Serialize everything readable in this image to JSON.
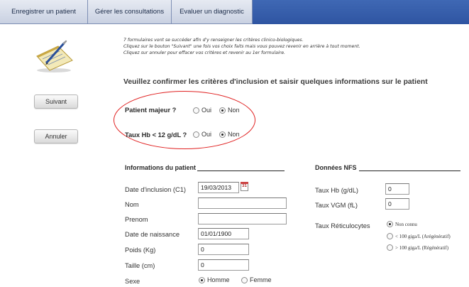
{
  "tabs": [
    {
      "label": "Enregistrer un patient"
    },
    {
      "label": "Gérer les consultations"
    },
    {
      "label": "Evaluer un diagnostic"
    }
  ],
  "instructions": [
    "7 formulaires vont se succéder afin d'y renseigner les critères clinico-biologiques.",
    "Cliquez sur le bouton \"Suivant\" une fois vos choix faits mais vous pouvez revenir en arrière à tout moment.",
    "Cliquez sur annuler pour effacer vos critères et revenir au 1er formulaire."
  ],
  "confirm_title": "Veuillez confirmer les critères d'inclusion et saisir quelques informations sur le patient",
  "buttons": {
    "next": "Suivant",
    "cancel": "Annuler"
  },
  "criteria": {
    "major": {
      "label": "Patient majeur ?",
      "oui": "Oui",
      "non": "Non",
      "selected": "Non"
    },
    "hb": {
      "label": "Taux Hb < 12 g/dL ?",
      "oui": "Oui",
      "non": "Non",
      "selected": "Non"
    }
  },
  "patient_info": {
    "title": "Informations du patient",
    "fields": {
      "inclusion_date": {
        "label": "Date d'inclusion (C1)",
        "value": "19/03/2013"
      },
      "nom": {
        "label": "Nom",
        "value": ""
      },
      "prenom": {
        "label": "Prenom",
        "value": ""
      },
      "birth_date": {
        "label": "Date de naissance",
        "value": "01/01/1900"
      },
      "poids": {
        "label": "Poids (Kg)",
        "value": "0"
      },
      "taille": {
        "label": "Taille (cm)",
        "value": "0"
      }
    },
    "sexe": {
      "label": "Sexe",
      "homme": "Homme",
      "femme": "Femme",
      "selected": "Homme"
    },
    "calendar_day": "31"
  },
  "nfs": {
    "title": "Données NFS",
    "hb": {
      "label": "Taux Hb (g/dL)",
      "value": "0"
    },
    "vgm": {
      "label": "Taux VGM (fL)",
      "value": "0"
    },
    "reticulo": {
      "label": "Taux Réticulocytes",
      "options": [
        "Non connu",
        "< 100 giga/L (Arégénératif)",
        "> 100 giga/L (Régénératif)"
      ],
      "selected": "Non connu"
    }
  }
}
